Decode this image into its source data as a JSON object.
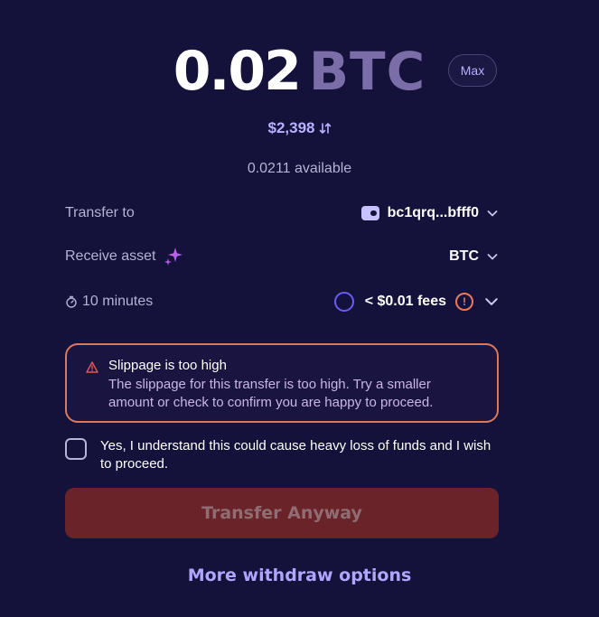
{
  "amount": {
    "value": "0.02",
    "unit": "BTC",
    "max_label": "Max"
  },
  "fiat": {
    "value": "$2,398",
    "swap_icon": "swap-arrows-icon"
  },
  "available": "0.0211 available",
  "transfer_to": {
    "label": "Transfer to",
    "address": "bc1qrq...bfff0",
    "icon": "wallet-icon"
  },
  "receive_asset": {
    "label": "Receive asset",
    "asset": "BTC",
    "icon": "sparkle-icon"
  },
  "timing": {
    "duration": "10 minutes",
    "fees": "< $0.01 fees"
  },
  "alert": {
    "title": "Slippage is too high",
    "body": "The slippage for this transfer is too high. Try a smaller amount or check to confirm you are happy to proceed."
  },
  "acknowledge": {
    "text": "Yes, I understand this could cause heavy loss of funds and I wish to proceed.",
    "checked": false
  },
  "transfer_button": "Transfer Anyway",
  "more_options": "More withdraw options",
  "colors": {
    "background": "#14123a",
    "accent": "#b1a6ff",
    "warning": "#d9795c",
    "danger_button": "#6a2429"
  }
}
